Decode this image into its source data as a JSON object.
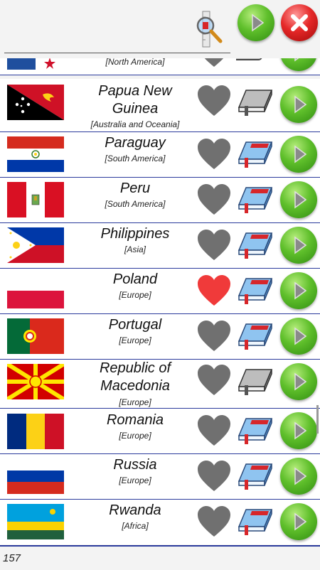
{
  "toolbar": {
    "search_icon": "magnifier-search-icon",
    "go_icon": "play-arrow-icon",
    "close_icon": "close-x-icon"
  },
  "countries": [
    {
      "name": "",
      "region": "[North America]",
      "favorite": false,
      "book": "gray"
    },
    {
      "name": "Papua New Guinea",
      "region": "[Australia and Oceania]",
      "favorite": false,
      "book": "gray"
    },
    {
      "name": "Paraguay",
      "region": "[South America]",
      "favorite": false,
      "book": "blue"
    },
    {
      "name": "Peru",
      "region": "[South America]",
      "favorite": false,
      "book": "blue"
    },
    {
      "name": "Philippines",
      "region": "[Asia]",
      "favorite": false,
      "book": "blue"
    },
    {
      "name": "Poland",
      "region": "[Europe]",
      "favorite": true,
      "book": "blue"
    },
    {
      "name": "Portugal",
      "region": "[Europe]",
      "favorite": false,
      "book": "blue"
    },
    {
      "name": "Republic of Macedonia",
      "region": "[Europe]",
      "favorite": false,
      "book": "gray"
    },
    {
      "name": "Romania",
      "region": "[Europe]",
      "favorite": false,
      "book": "blue"
    },
    {
      "name": "Russia",
      "region": "[Europe]",
      "favorite": false,
      "book": "blue"
    },
    {
      "name": "Rwanda",
      "region": "[Africa]",
      "favorite": false,
      "book": "blue"
    }
  ],
  "footer": {
    "count": "157"
  },
  "colors": {
    "divider": "#2a3a9c",
    "heart_favorite": "#f03a3a",
    "heart_default": "#707070",
    "go_green": "#5fbf2b",
    "close_red": "#e52828"
  }
}
